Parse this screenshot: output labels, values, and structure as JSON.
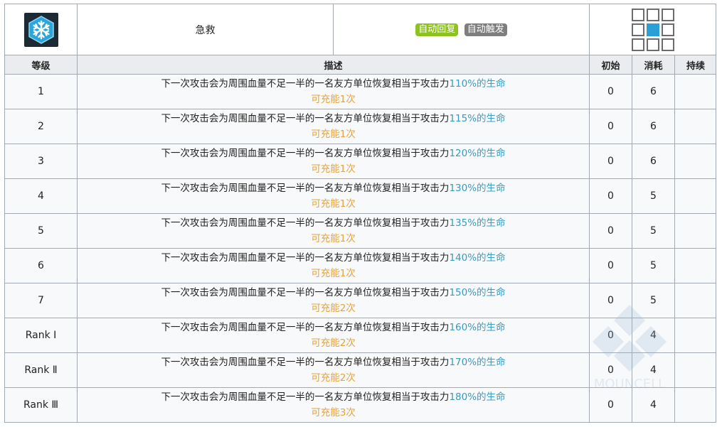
{
  "skill": {
    "icon": "snowflake-skill-icon",
    "name": "急救",
    "recovery_type": "自动回复",
    "trigger_type": "自动触发"
  },
  "range": {
    "cells": [
      "empty",
      "empty",
      "empty",
      "empty",
      "self",
      "empty",
      "empty",
      "empty",
      "empty"
    ]
  },
  "headers": {
    "level": "等级",
    "description": "描述",
    "initial": "初始",
    "cost": "消耗",
    "duration": "持续"
  },
  "description_prefix": "下一次攻击会为周围血量不足一半的一名友方单位恢复相当于攻击力",
  "rows": [
    {
      "level": "1",
      "value": "110%的生命",
      "charge": "可充能1次",
      "initial": "0",
      "cost": "6",
      "duration": ""
    },
    {
      "level": "2",
      "value": "115%的生命",
      "charge": "可充能1次",
      "initial": "0",
      "cost": "6",
      "duration": ""
    },
    {
      "level": "3",
      "value": "120%的生命",
      "charge": "可充能1次",
      "initial": "0",
      "cost": "6",
      "duration": ""
    },
    {
      "level": "4",
      "value": "130%的生命",
      "charge": "可充能1次",
      "initial": "0",
      "cost": "5",
      "duration": ""
    },
    {
      "level": "5",
      "value": "135%的生命",
      "charge": "可充能1次",
      "initial": "0",
      "cost": "5",
      "duration": ""
    },
    {
      "level": "6",
      "value": "140%的生命",
      "charge": "可充能1次",
      "initial": "0",
      "cost": "5",
      "duration": ""
    },
    {
      "level": "7",
      "value": "150%的生命",
      "charge": "可充能2次",
      "initial": "0",
      "cost": "5",
      "duration": ""
    },
    {
      "level": "Rank Ⅰ",
      "value": "160%的生命",
      "charge": "可充能2次",
      "initial": "0",
      "cost": "4",
      "duration": ""
    },
    {
      "level": "Rank Ⅱ",
      "value": "170%的生命",
      "charge": "可充能2次",
      "initial": "0",
      "cost": "4",
      "duration": ""
    },
    {
      "level": "Rank Ⅲ",
      "value": "180%的生命",
      "charge": "可充能3次",
      "initial": "0",
      "cost": "4",
      "duration": ""
    }
  ],
  "watermark": {
    "text": "MOUNCELL"
  },
  "colors": {
    "highlight": "#3a9ac0",
    "charge": "#e6a23c",
    "badge_green": "#8ec31f",
    "badge_gray": "#7e7e7e",
    "range_self": "#2a9fd8"
  }
}
